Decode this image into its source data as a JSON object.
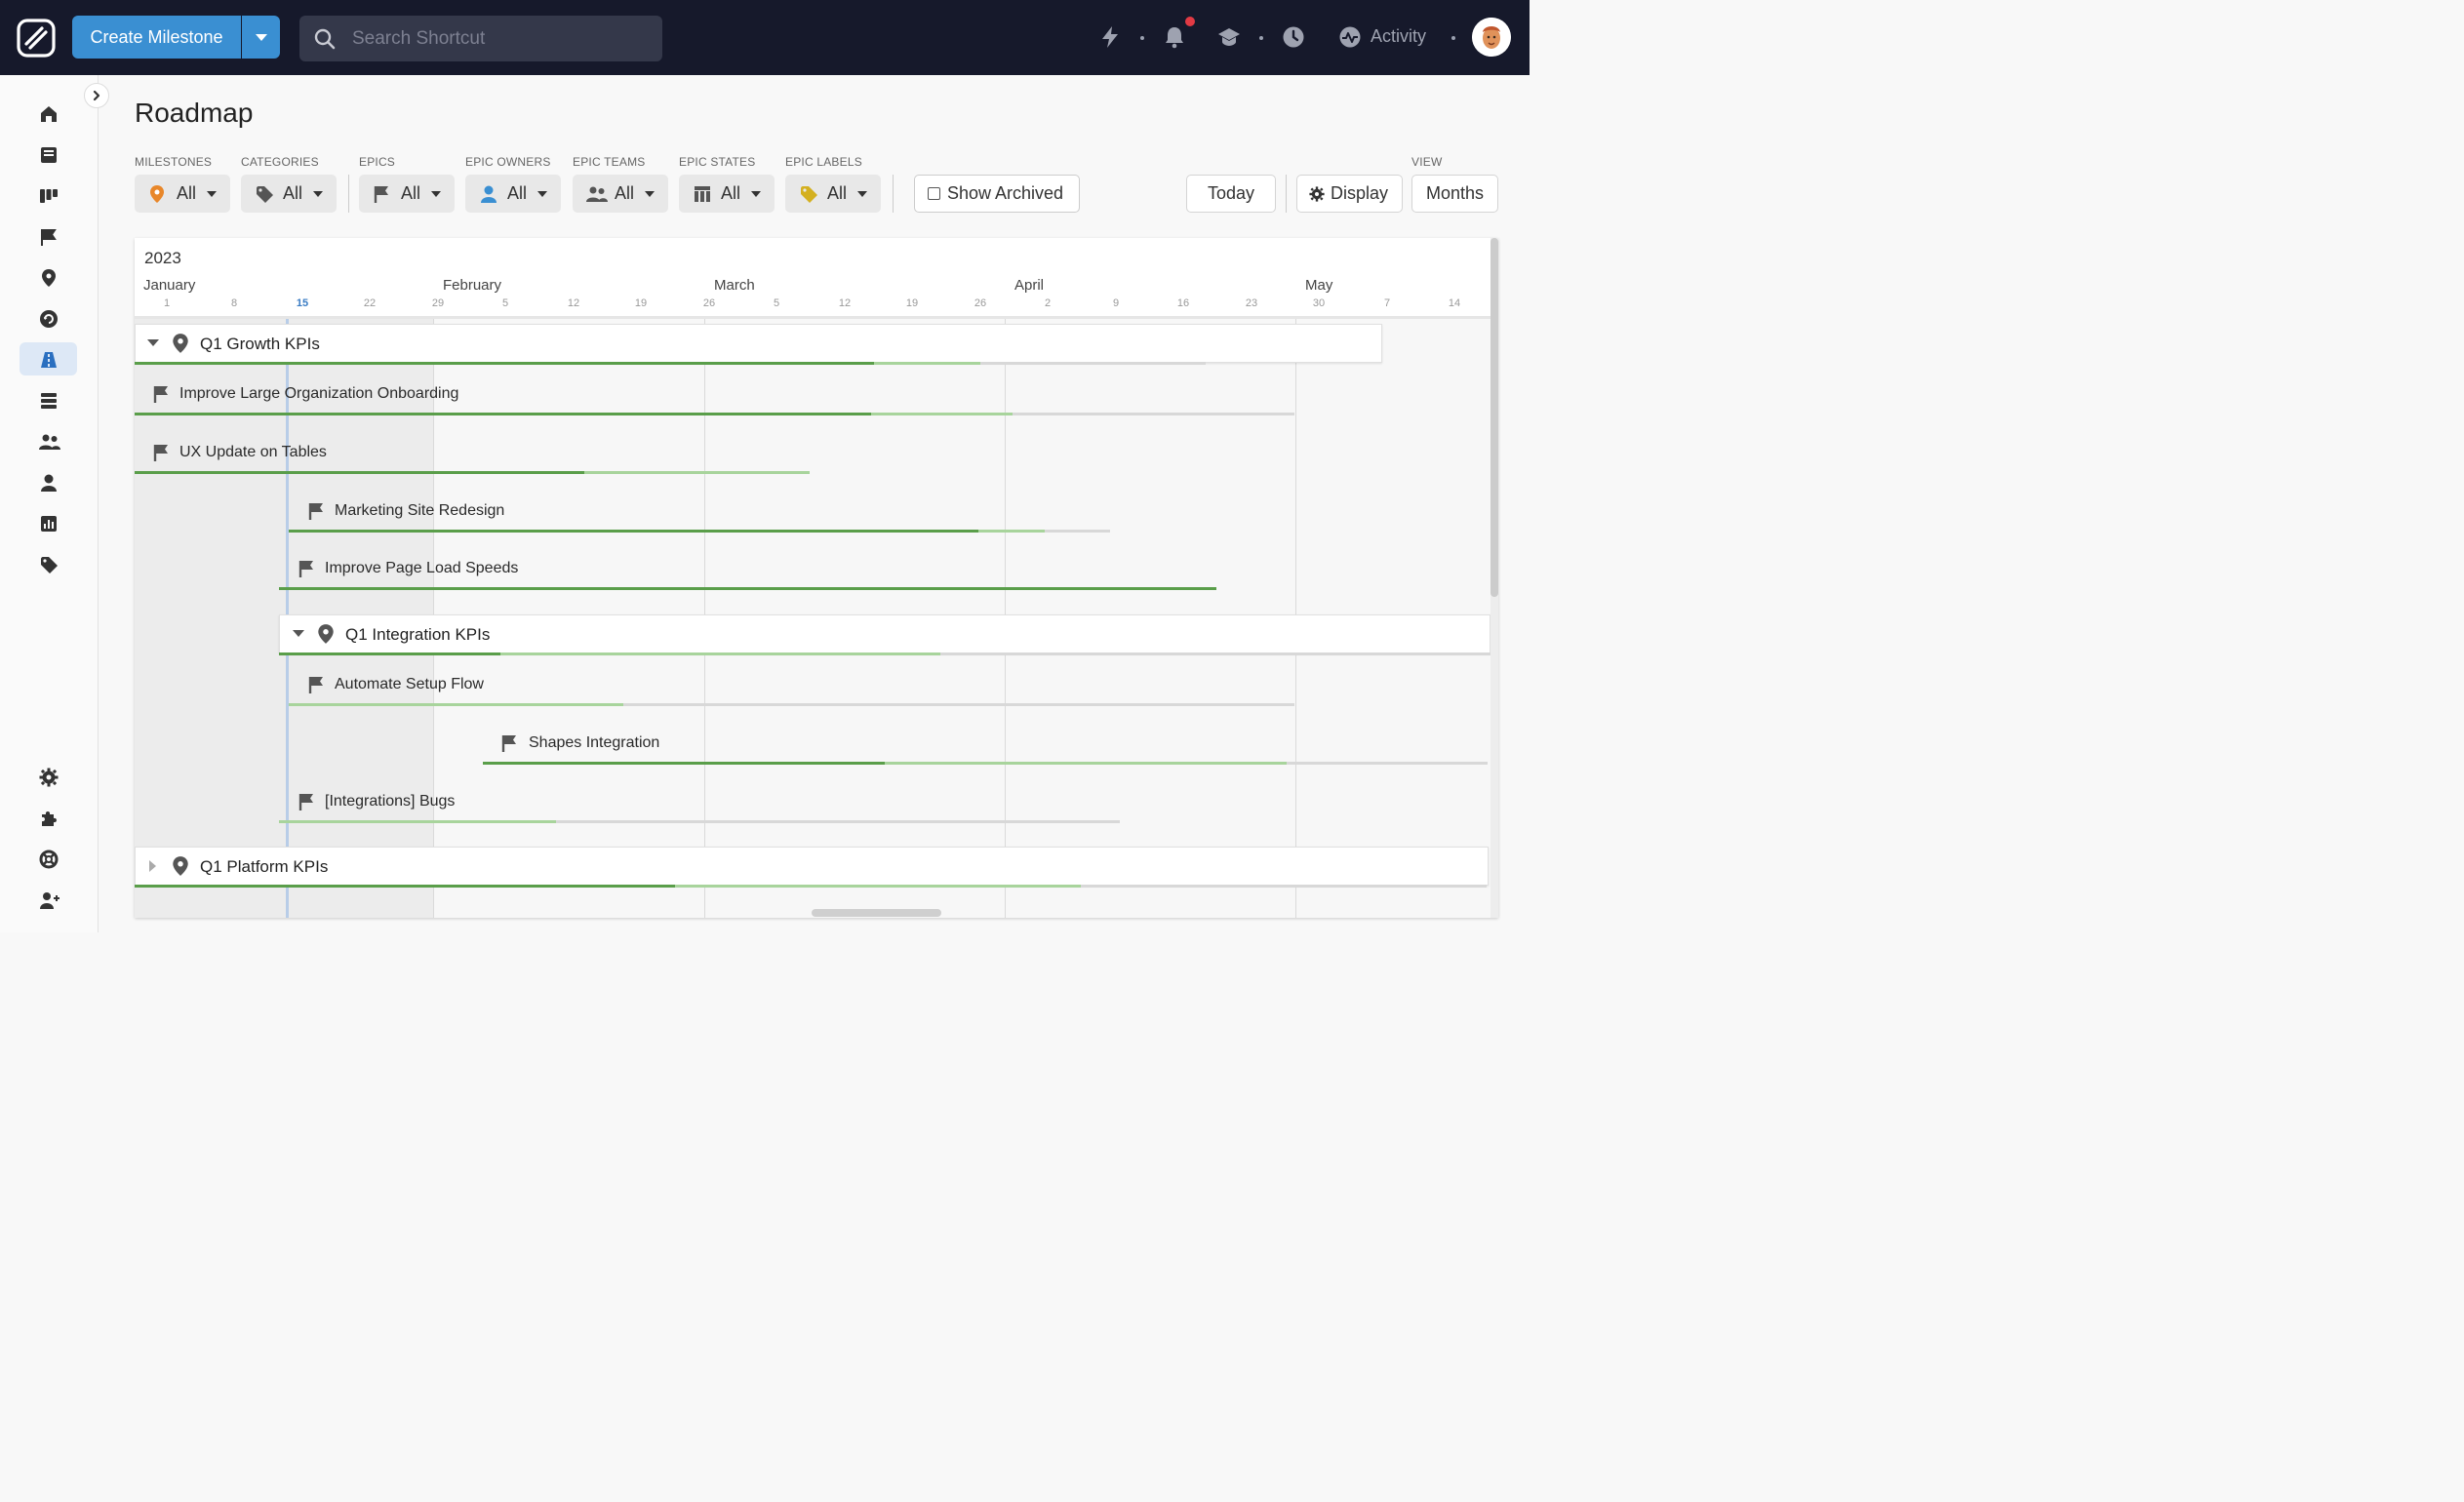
{
  "topbar": {
    "create_label": "Create Milestone",
    "search_placeholder": "Search Shortcut",
    "activity_label": "Activity",
    "icons": [
      "lightning-icon",
      "bell-icon",
      "graduation-cap-icon",
      "clock-icon",
      "activity-icon"
    ],
    "notification_color": "#e23a44",
    "accent_color": "#3a8fd2"
  },
  "sidebar": {
    "items": [
      "home-icon",
      "stories-icon",
      "board-icon",
      "epics-icon",
      "milestones-icon",
      "iterations-icon",
      "roadmap-icon",
      "objectives-icon",
      "teams-icon",
      "user-icon",
      "reports-icon",
      "labels-icon",
      "settings-icon",
      "integrations-icon",
      "help-icon",
      "invite-icon"
    ],
    "active": "roadmap-icon"
  },
  "page": {
    "title": "Roadmap"
  },
  "filters": [
    {
      "label": "MILESTONES",
      "value": "All",
      "icon": "map-pin-icon"
    },
    {
      "label": "CATEGORIES",
      "value": "All",
      "icon": "tag-icon"
    },
    {
      "label": "EPICS",
      "value": "All",
      "icon": "flag-icon"
    },
    {
      "label": "EPIC OWNERS",
      "value": "All",
      "icon": "user-icon"
    },
    {
      "label": "EPIC TEAMS",
      "value": "All",
      "icon": "team-icon"
    },
    {
      "label": "EPIC STATES",
      "value": "All",
      "icon": "columns-icon"
    },
    {
      "label": "EPIC LABELS",
      "value": "All",
      "icon": "label-icon"
    }
  ],
  "controls": {
    "show_archived": "Show Archived",
    "show_archived_checked": false,
    "today": "Today",
    "display": "Display",
    "view_label": "VIEW",
    "view_value": "Months"
  },
  "timeline": {
    "year": "2023",
    "months": [
      "January",
      "February",
      "March",
      "April",
      "May"
    ],
    "ticks": [
      "1",
      "8",
      "15",
      "22",
      "29",
      "5",
      "12",
      "19",
      "26",
      "5",
      "12",
      "19",
      "26",
      "2",
      "9",
      "16",
      "23",
      "30",
      "7",
      "14"
    ],
    "today_tick": "15"
  },
  "rows": [
    {
      "type": "milestone",
      "name": "Q1 Growth KPIs",
      "expanded": true,
      "progress_done": 0.69,
      "progress_started": 0.79
    },
    {
      "type": "epic",
      "name": "Improve Large Organization Onboarding",
      "progress_done": 0.635,
      "progress_started": 0.757
    },
    {
      "type": "epic",
      "name": "UX Update on Tables",
      "progress_done": 0.666,
      "progress_started": 1.0
    },
    {
      "type": "epic",
      "name": "Marketing Site Redesign",
      "progress_done": 0.84,
      "progress_started": 0.92
    },
    {
      "type": "epic",
      "name": "Improve Page Load Speeds",
      "progress_done": 1.0,
      "progress_started": 1.0
    },
    {
      "type": "milestone",
      "name": "Q1 Integration KPIs",
      "expanded": true,
      "progress_done": 0.183,
      "progress_started": 0.546
    },
    {
      "type": "epic",
      "name": "Automate Setup Flow",
      "progress_done": 0.0,
      "progress_started": 0.333
    },
    {
      "type": "epic",
      "name": "Shapes Integration",
      "progress_done": 0.4,
      "progress_started": 0.8
    },
    {
      "type": "epic",
      "name": "[Integrations] Bugs",
      "progress_done": 0.0,
      "progress_started": 0.33
    },
    {
      "type": "milestone",
      "name": "Q1 Platform KPIs",
      "expanded": false,
      "progress_done": 0.4,
      "progress_started": 0.7
    }
  ]
}
